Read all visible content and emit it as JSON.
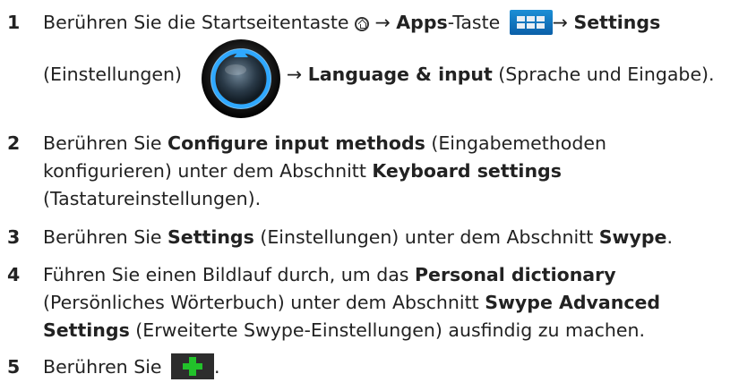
{
  "steps": [
    {
      "number": "1",
      "line1": {
        "t1": "Berühren Sie die Startseitentaste",
        "arrow1": "→",
        "apps": "Apps",
        "t2": "-Taste",
        "arrow2": "→",
        "settings": "Settings"
      },
      "line2": {
        "t1": "(Einstellungen)",
        "arrow": "→",
        "language": "Language & input",
        "t2": "(Sprache und Eingabe)."
      }
    },
    {
      "number": "2",
      "a": "Berühren Sie",
      "b": "Configure input methods",
      "c": "(Eingabemethoden",
      "d": "konfigurieren) unter dem Abschnitt",
      "e": "Keyboard settings",
      "f": "(Tastatureinstellungen)."
    },
    {
      "number": "3",
      "a": "Berühren Sie",
      "b": "Settings",
      "c": "(Einstellungen) unter dem Abschnitt",
      "d": "Swype",
      "e": "."
    },
    {
      "number": "4",
      "a": "Führen Sie einen Bildlauf durch, um das",
      "b": "Personal dictionary",
      "c": "(Persönliches Wörterbuch) unter dem Abschnitt",
      "d": "Swype Advanced",
      "e": "Settings",
      "f": "(Erweiterte Swype-Einstellungen) ausfindig zu machen."
    },
    {
      "number": "5",
      "a": "Berühren Sie",
      "b": "."
    }
  ],
  "icons": {
    "home": "home-button-icon",
    "apps": "apps-grid-icon",
    "settings": "settings-dial-icon",
    "add": "plus-add-icon"
  },
  "colors": {
    "text": "#222222",
    "apps_blue": "#1c8fd6",
    "plus_green": "#22c22a"
  }
}
